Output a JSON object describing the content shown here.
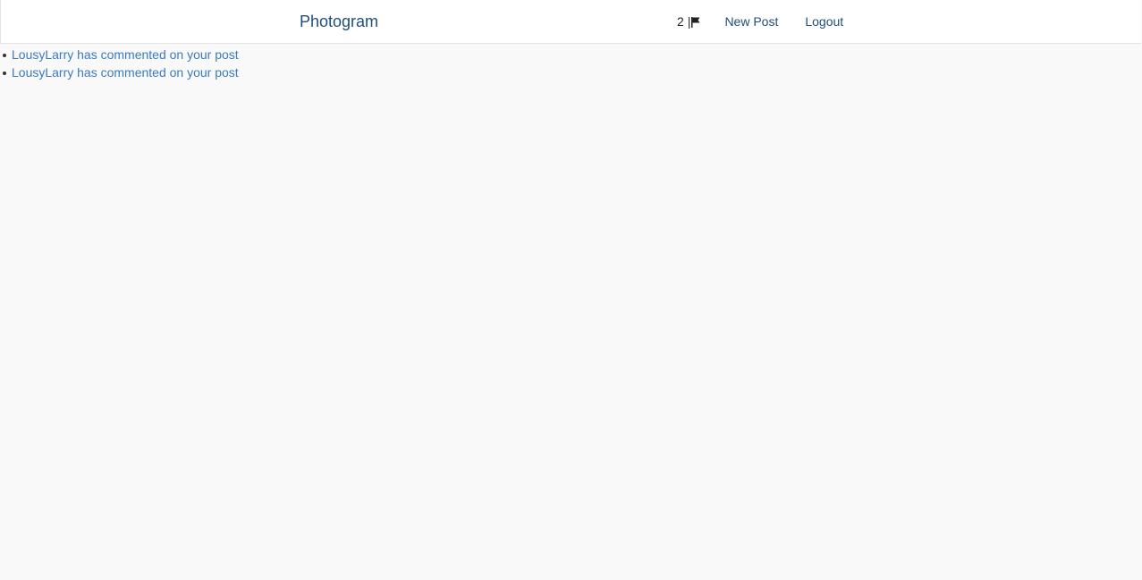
{
  "navbar": {
    "brand": "Photogram",
    "notification_count": "2",
    "notification_separator": "|",
    "notification_icon": "flag-icon",
    "new_post_label": "New Post",
    "logout_label": "Logout"
  },
  "notifications": [
    {
      "text": "LousyLarry has commented on your post"
    },
    {
      "text": "LousyLarry has commented on your post"
    }
  ],
  "colors": {
    "brand": "#1f4e79",
    "link": "#3a7bbf",
    "background": "#f9f9f9"
  }
}
